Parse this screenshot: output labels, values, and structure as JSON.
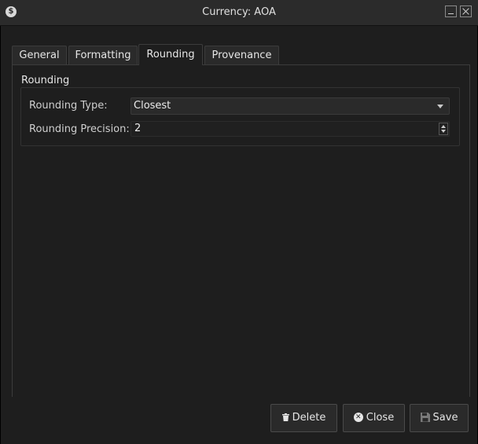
{
  "window": {
    "title": "Currency: AOA",
    "app_icon_glyph": "$"
  },
  "tabs": [
    {
      "label": "General",
      "active": false
    },
    {
      "label": "Formatting",
      "active": false
    },
    {
      "label": "Rounding",
      "active": true
    },
    {
      "label": "Provenance",
      "active": false
    }
  ],
  "rounding": {
    "group_title": "Rounding",
    "type_label": "Rounding Type:",
    "type_value": "Closest",
    "precision_label": "Rounding Precision:",
    "precision_value": "2"
  },
  "buttons": {
    "delete": "Delete",
    "close": "Close",
    "save": "Save"
  },
  "icons": {
    "delete": "trash-icon",
    "close": "x-circle-icon",
    "save": "floppy-disk-icon"
  }
}
